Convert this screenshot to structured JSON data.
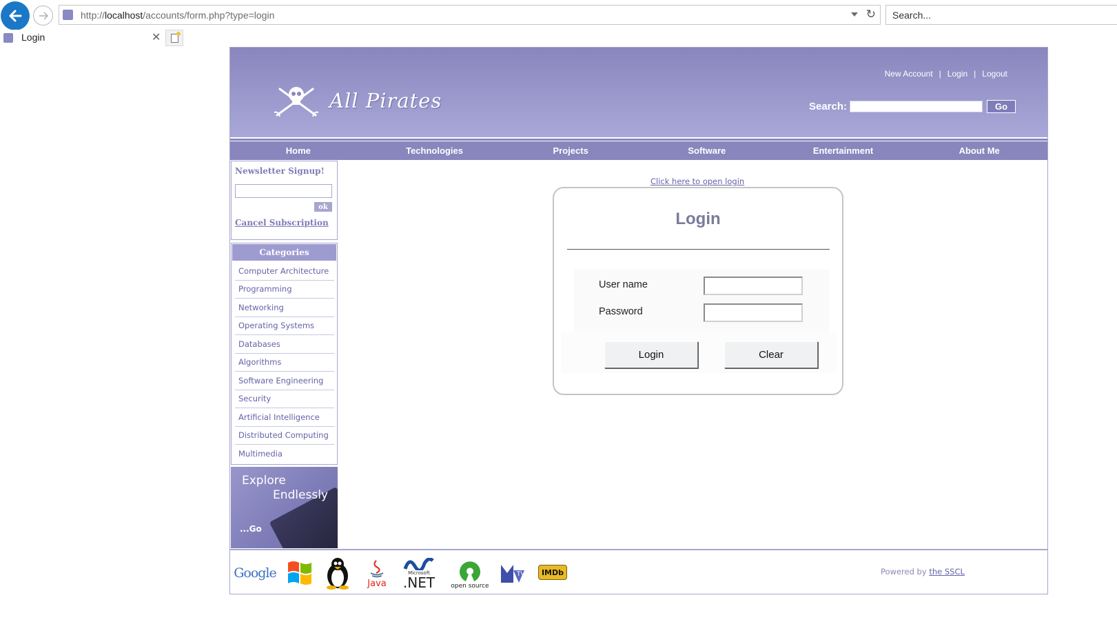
{
  "browser": {
    "url_prefix": "http://",
    "url_host": "localhost",
    "url_path": "/accounts/form.php?type=login",
    "search_placeholder": "Search...",
    "tab_title": "Login"
  },
  "header": {
    "logo_text": "All Pirates",
    "top_links": [
      "New Account",
      "Login",
      "Logout"
    ],
    "search_label": "Search:",
    "go_label": "Go"
  },
  "nav": [
    "Home",
    "Technologies",
    "Projects",
    "Software",
    "Entertainment",
    "About Me"
  ],
  "sidebar": {
    "newsletter_title": "Newsletter Signup!",
    "ok_label": "ok",
    "cancel_label": "Cancel Subscription",
    "categories_title": "Categories",
    "categories": [
      "Computer Architecture",
      "Programming",
      "Networking",
      "Operating Systems",
      "Databases",
      "Algorithms",
      "Software Engineering",
      "Security",
      "Artificial Intelligence",
      "Distributed Computing",
      "Multimedia"
    ],
    "banner_line1": "Explore",
    "banner_line2": "Endlessly",
    "banner_go": "...Go"
  },
  "main": {
    "open_login_link": "Click here to open login",
    "login_title": "Login",
    "username_label": "User name",
    "password_label": "Password",
    "login_button": "Login",
    "clear_button": "Clear"
  },
  "footer": {
    "logos": [
      "Google",
      "Windows",
      "Linux",
      "Java",
      "Microsoft .NET",
      "open source",
      "MTV",
      "IMDb"
    ],
    "google_text": "Google",
    "java_text": "Java",
    "net_small": "Microsoft",
    "net_text": ".NET",
    "opensource_text": "open source",
    "imdb_text": "IMDb",
    "powered_prefix": "Powered by ",
    "powered_link": "the SSCL"
  }
}
